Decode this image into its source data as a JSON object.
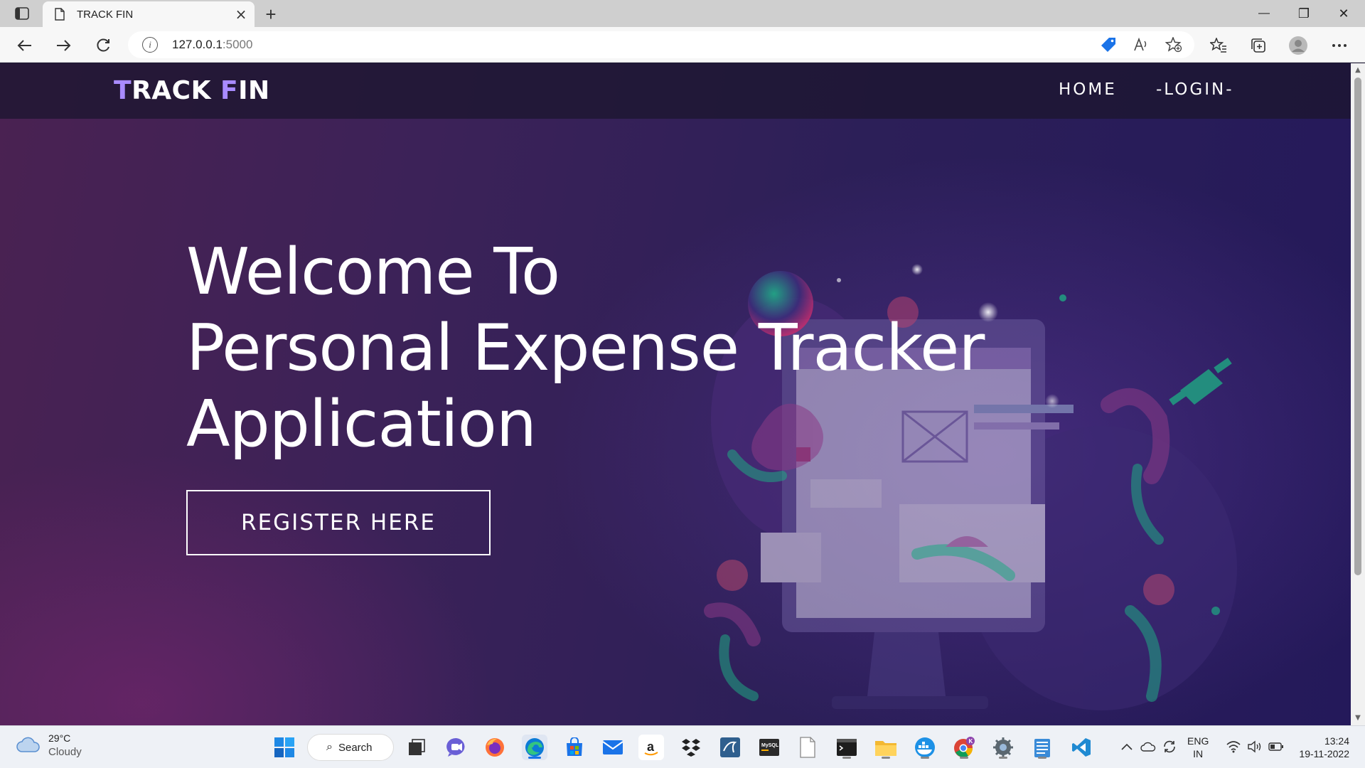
{
  "browser": {
    "tab_title": "TRACK FIN",
    "new_tab_symbol": "+",
    "url_host": "127.0.0.1",
    "url_port": ":5000",
    "controls": {
      "minimize": "—",
      "restore": "❐",
      "close": "✕"
    }
  },
  "site": {
    "logo": {
      "first_letter": "T",
      "part1": "RACK ",
      "accent_letter": "F",
      "part2": "IN"
    },
    "nav": [
      {
        "label": "HOME"
      },
      {
        "label": "-LOGIN-"
      }
    ],
    "hero": {
      "lines": [
        "Welcome To",
        "Personal Expense Tracker",
        "Application"
      ],
      "button": "REGISTER HERE"
    }
  },
  "taskbar": {
    "weather": {
      "temp": "29°C",
      "condition": "Cloudy"
    },
    "search_label": "Search",
    "language": {
      "line1": "ENG",
      "line2": "IN"
    },
    "clock": {
      "time": "13:24",
      "date": "19-11-2022"
    },
    "apps": [
      {
        "name": "windows-start-icon"
      },
      {
        "name": "task-view-icon"
      },
      {
        "name": "teams-chat-icon"
      },
      {
        "name": "firefox-icon"
      },
      {
        "name": "edge-icon"
      },
      {
        "name": "microsoft-store-icon"
      },
      {
        "name": "mail-icon"
      },
      {
        "name": "amazon-icon"
      },
      {
        "name": "dropbox-icon"
      },
      {
        "name": "mysql-workbench-icon"
      },
      {
        "name": "mysql-shell-icon"
      },
      {
        "name": "blank-document-icon"
      },
      {
        "name": "terminal-icon"
      },
      {
        "name": "file-explorer-icon"
      },
      {
        "name": "docker-icon"
      },
      {
        "name": "chrome-icon"
      },
      {
        "name": "settings-icon"
      },
      {
        "name": "notepad-icon"
      },
      {
        "name": "vscode-icon"
      }
    ]
  },
  "colors": {
    "logo_accent": "#a98bff",
    "page_bg_left": "#4a2252",
    "page_bg_right": "#24195a",
    "header_bg": "#1c1630"
  }
}
